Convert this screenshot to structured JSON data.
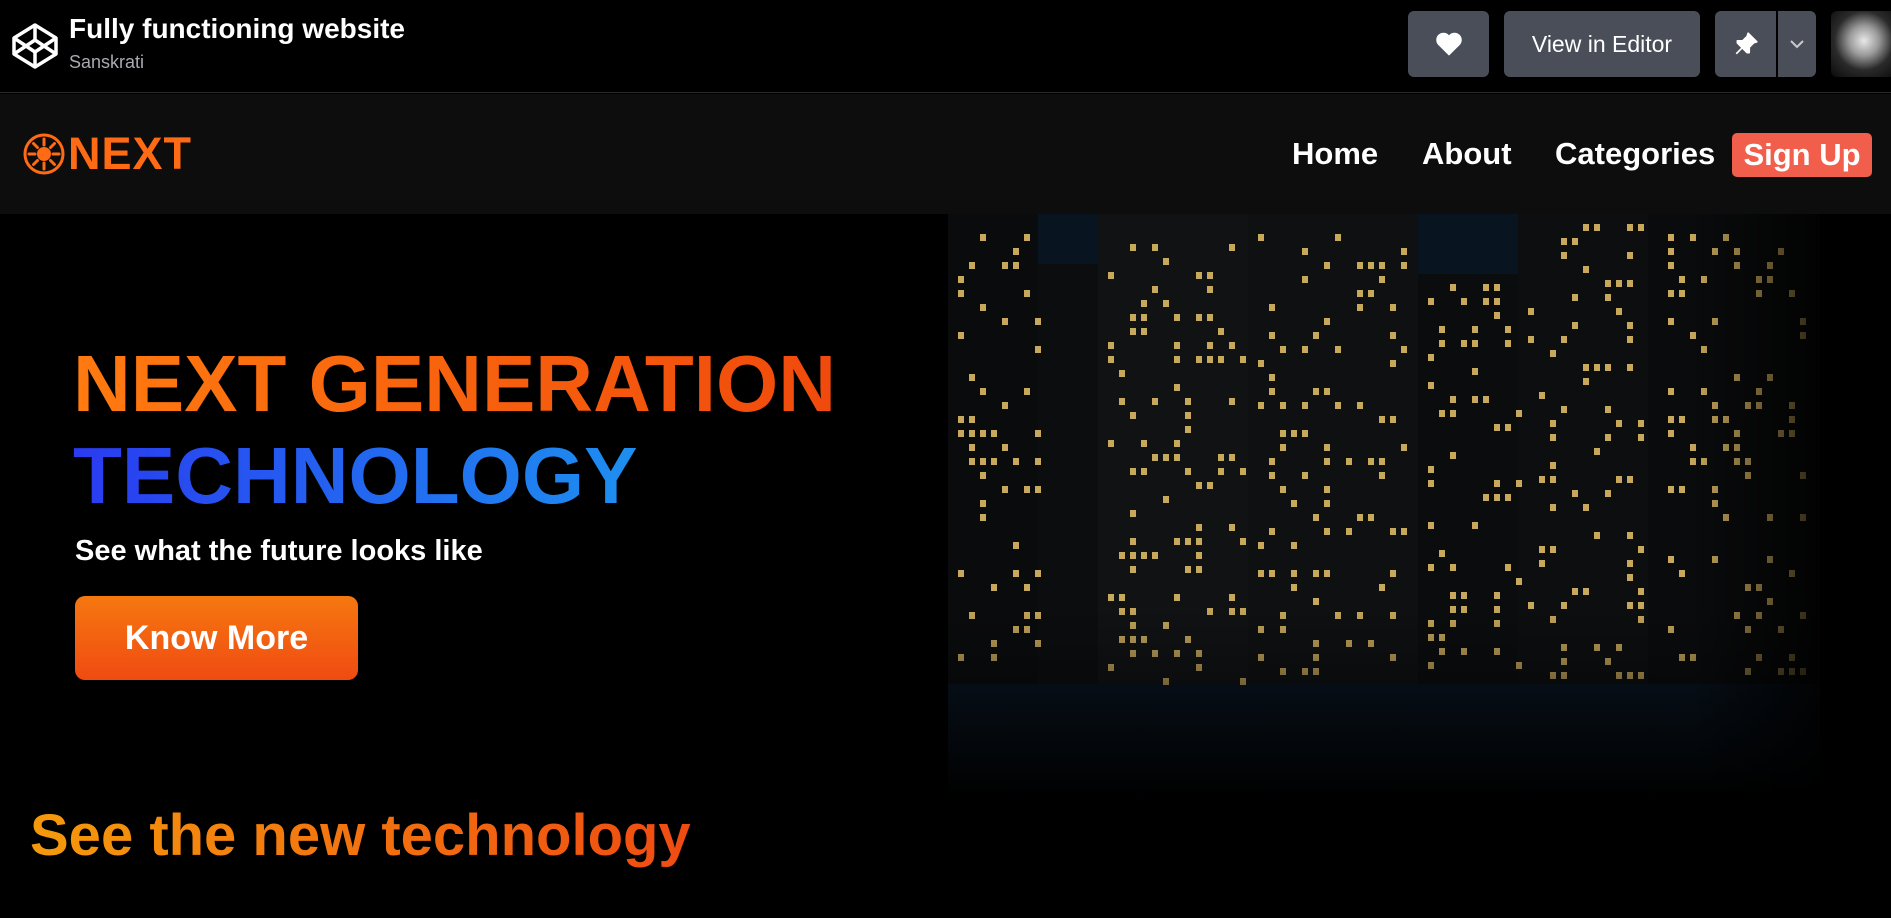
{
  "codepen": {
    "title": "Fully functioning website",
    "author": "Sanskrati",
    "heart_icon": "heart-icon",
    "view_in_editor": "View in Editor",
    "pin_icon": "pin-icon",
    "dropdown_icon": "chevron-down-icon"
  },
  "site": {
    "brand": "NEXT",
    "nav": {
      "home": "Home",
      "about": "About",
      "categories": "Categories",
      "signup": "Sign Up"
    },
    "hero": {
      "line1": "NEXT GENERATION",
      "line2": "TECHNOLOGY",
      "tagline": "See what the future looks like",
      "cta": "Know More"
    },
    "section_title": "See the new technology"
  },
  "colors": {
    "accent_orange": "#ff6a14",
    "accent_blue": "#1d8ff0",
    "signup_bg": "#f15e4b",
    "codepen_button": "#4a4e59"
  }
}
